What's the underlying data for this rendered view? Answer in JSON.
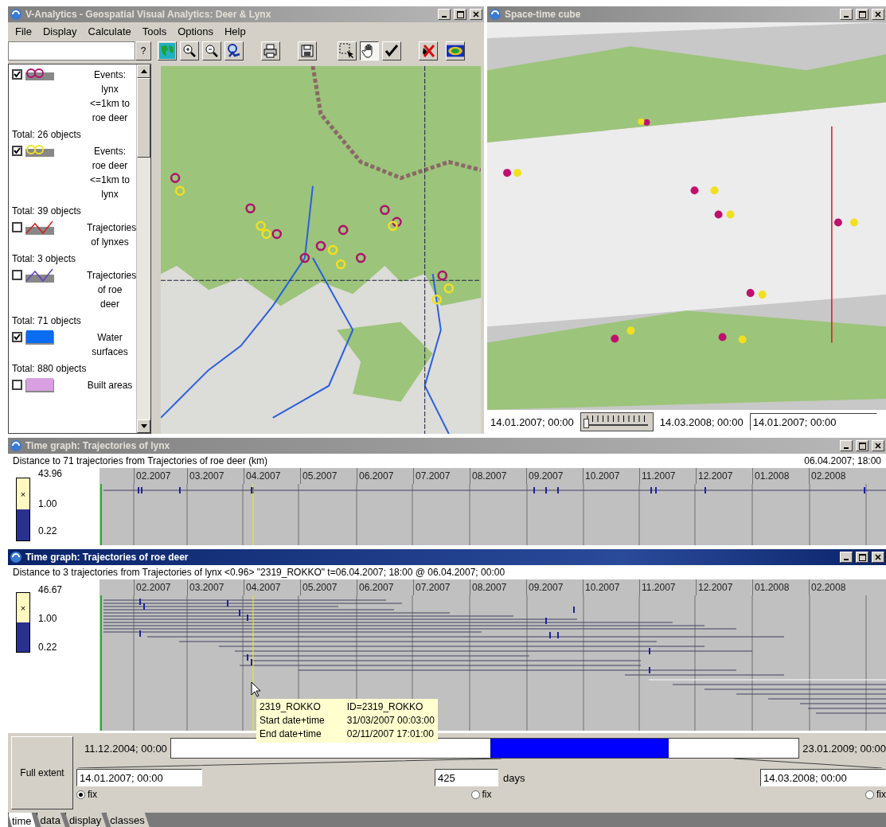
{
  "main_window": {
    "title": "V-Analytics - Geospatial Visual Analytics: Deer & Lynx",
    "active": false,
    "menu": [
      "File",
      "Display",
      "Calculate",
      "Tools",
      "Options",
      "Help"
    ],
    "help_button": "?",
    "toolbar": [
      {
        "kind": "map",
        "selected": false
      },
      {
        "kind": "zoomin",
        "selected": false
      },
      {
        "kind": "zoomout",
        "selected": false
      },
      {
        "kind": "find",
        "selected": false
      },
      {
        "kind": "print",
        "selected": false
      },
      {
        "kind": "save",
        "selected": false
      },
      {
        "kind": "select",
        "selected": false
      },
      {
        "kind": "pan",
        "selected": true
      },
      {
        "kind": "confirm",
        "selected": false
      },
      {
        "kind": "erase",
        "selected": false
      },
      {
        "kind": "layers",
        "selected": false
      }
    ],
    "legend": [
      {
        "kind": "points",
        "color": "#b0106e",
        "checked": true,
        "label": "Events: lynx <=1km to roe deer",
        "total": "Total: 26 objects"
      },
      {
        "kind": "points",
        "color": "#f0e020",
        "checked": true,
        "label": "Events: roe deer <=1km to lynx",
        "total": "Total: 39 objects"
      },
      {
        "kind": "line",
        "color": "#d02020",
        "checked": false,
        "label": "Trajectories of lynxes",
        "total": "Total: 3 objects"
      },
      {
        "kind": "line",
        "color": "#6040c0",
        "checked": false,
        "label": "Trajectories of roe deer",
        "total": "Total: 71 objects"
      },
      {
        "kind": "area",
        "color": "#0a6cf0",
        "checked": true,
        "label": "Water surfaces",
        "total": "Total: 880 objects"
      },
      {
        "kind": "area",
        "color": "#d8a0e0",
        "checked": false,
        "label": "Built areas"
      }
    ]
  },
  "cube_window": {
    "title": "Space-time cube",
    "active": false,
    "start": "14.01.2007; 00:00",
    "slider": {
      "level": 0
    },
    "end": "14.03.2008; 00:00",
    "current": "14.01.2007; 00:00"
  },
  "time_graphs": [
    {
      "title": "Time graph: Trajectories of lynx",
      "active": false,
      "subtitle": "Distance to 71 trajectories from Trajectories of roe deer (km)",
      "time": "06.04.2007; 18:00",
      "scale": {
        "max": "43.96",
        "mid": "1.00",
        "min": "0.22",
        "mark": "×"
      },
      "months": [
        "02.2007",
        "03.2007",
        "04.2007",
        "05.2007",
        "06.2007",
        "07.2007",
        "08.2007",
        "09.2007",
        "10.2007",
        "11.2007",
        "12.2007",
        "01.2008",
        "02.2008"
      ]
    },
    {
      "title": "Time graph: Trajectories of roe deer",
      "active": true,
      "subtitle": "Distance to 3 trajectories from Trajectories of lynx <0.96> \"2319_ROKKO\" t=06.04.2007; 18:00 @ 06.04.2007; 00:00",
      "scale": {
        "max": "46.67",
        "mid": "1.00",
        "min": "0.22",
        "mark": "×"
      },
      "months": [
        "02.2007",
        "03.2007",
        "04.2007",
        "05.2007",
        "06.2007",
        "07.2007",
        "08.2007",
        "09.2007",
        "10.2007",
        "11.2007",
        "12.2007",
        "01.2008",
        "02.2008"
      ],
      "tooltip": [
        [
          "2319_ROKKO",
          "ID=2319_ROKKO"
        ],
        [
          "Start date+time",
          "31/03/2007 00:03:00"
        ],
        [
          "End date+time",
          "02/11/2007 17:01:00"
        ]
      ]
    }
  ],
  "extent": {
    "button": "Full extent",
    "from": "11.12.2004; 00:00",
    "to": "23.01.2009; 00:00",
    "selection_start": {
      "level": 0.51
    },
    "selection_end": {
      "level": 0.792
    },
    "start_field": "14.01.2007; 00:00",
    "duration_field": "425",
    "unit": "days",
    "end_field": "14.03.2008; 00:00",
    "fix": [
      {
        "label": "fix",
        "selected": true
      },
      {
        "label": "fix",
        "selected": false
      },
      {
        "label": "fix",
        "selected": false
      }
    ]
  },
  "tabs": [
    {
      "label": "time",
      "selected": true
    },
    {
      "label": "data",
      "selected": false
    },
    {
      "label": "display",
      "selected": false
    },
    {
      "label": "classes",
      "selected": false
    }
  ]
}
